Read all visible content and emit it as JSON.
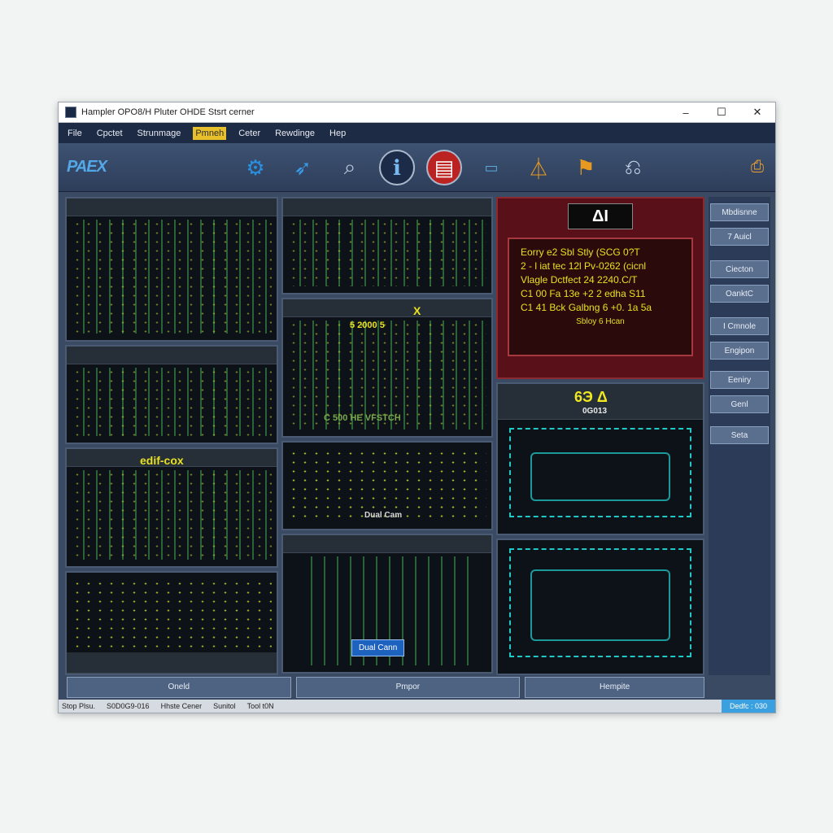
{
  "window": {
    "title": "Hampler OPO8/H Pluter OHDE Stsrt cerner",
    "minimize": "–",
    "maximize": "☐",
    "close": "✕"
  },
  "menu": [
    {
      "label": "File",
      "active": false
    },
    {
      "label": "Cpctet",
      "active": false
    },
    {
      "label": "Strunmage",
      "active": false
    },
    {
      "label": "Pmneh",
      "active": true
    },
    {
      "label": "Ceter",
      "active": false
    },
    {
      "label": "Rewdinge",
      "active": false
    },
    {
      "label": "Hep",
      "active": false
    }
  ],
  "toolbar": {
    "logo": "PAEX",
    "print_icon": "printer-icon"
  },
  "panels": {
    "p3_title": "edif-cox",
    "p6_badge": "X",
    "p6_line": "5 2000 5",
    "p6_caption": "C 500 HE VFSTCH",
    "p7_caption": "Dual Cam",
    "p8_button": "Dual Cann",
    "red_title": "ΔΙ",
    "red_lines": [
      "Eorry   e2 Sbl Stly      (SCG 0?T",
      "2  - l iat tec  12l  Pv-0262 (cicnl",
      "Vlagle Dctfect  24          2240.C/T",
      "C1  00   Fa 13e +2 2 edha      S11",
      "C1 41  Bck    Galbng 6  +0. 1a 5a"
    ],
    "red_footer": "Sbloy 6 Hcan",
    "p10_title": "6Э Δ",
    "p10_sub": "0G013"
  },
  "sidebar": [
    "Mbdisnne",
    "7 Auicl",
    "Ciecton",
    "OanktC",
    "I Cmnole",
    "Engipon",
    "Eeniry",
    "Genl",
    "Seta"
  ],
  "bottom": [
    "Oneld",
    "Pmpor",
    "Hempite"
  ],
  "status": {
    "left": "Stop Plsu.",
    "id": "S0D0G9-016",
    "item": "Hhste Cener",
    "mode": "Sunitol",
    "tool": "Tool t0N",
    "right": "Dedfc : 030"
  }
}
